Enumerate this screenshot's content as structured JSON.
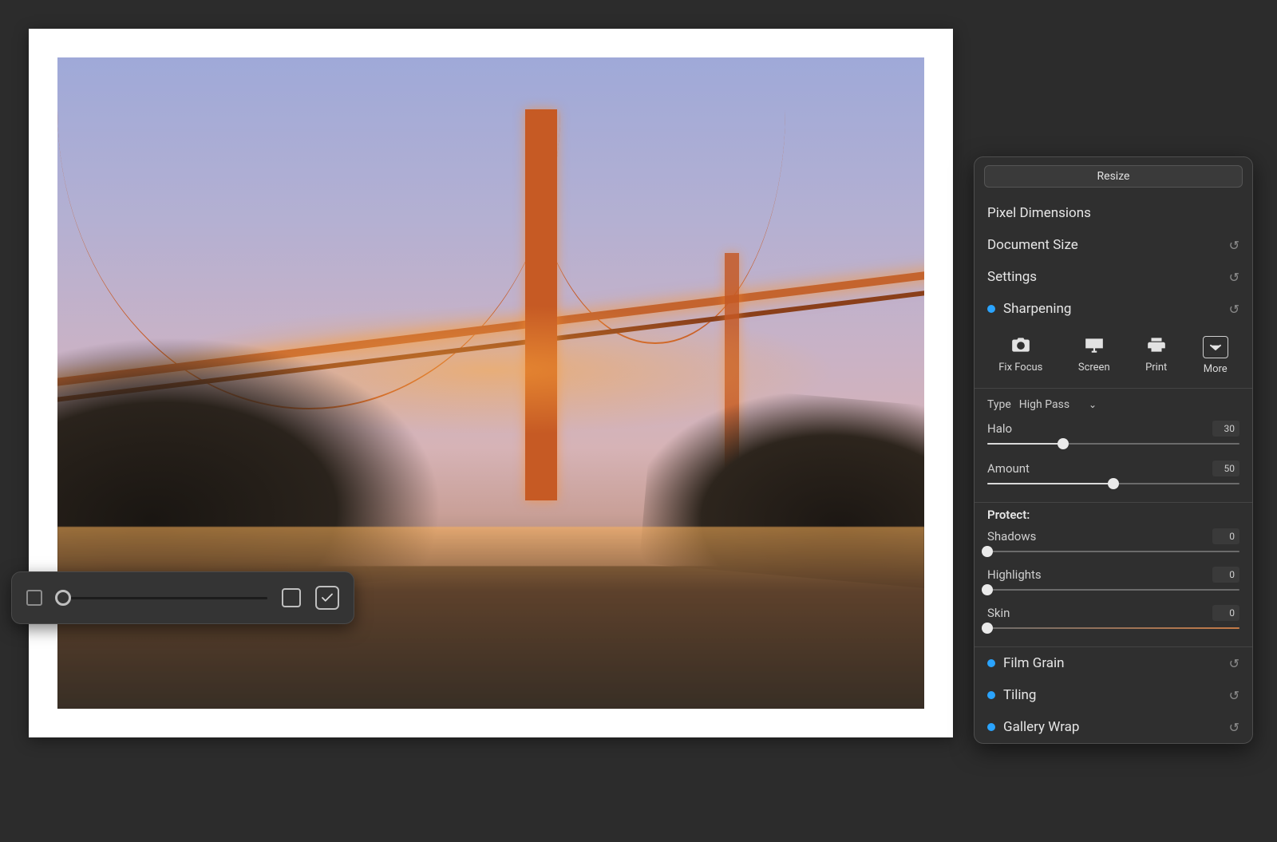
{
  "canvas": {
    "description": "Golden Gate Bridge at dusk, warm lights on bridge, purple sky, rocky beach foreground, reflections in wet sand"
  },
  "zoom_bar": {
    "slider_percent": 3
  },
  "panel": {
    "resize_label": "Resize",
    "sections": {
      "pixel_dimensions": "Pixel Dimensions",
      "document_size": "Document Size",
      "settings": "Settings",
      "sharpening": "Sharpening",
      "film_grain": "Film Grain",
      "tiling": "Tiling",
      "gallery_wrap": "Gallery Wrap"
    },
    "icons": {
      "fix_focus": "Fix Focus",
      "screen": "Screen",
      "print": "Print",
      "more": "More"
    },
    "type_label": "Type",
    "type_value": "High Pass",
    "halo": {
      "label": "Halo",
      "value": 30,
      "percent": 30
    },
    "amount": {
      "label": "Amount",
      "value": 50,
      "percent": 50
    },
    "protect_label": "Protect:",
    "shadows": {
      "label": "Shadows",
      "value": 0,
      "percent": 0
    },
    "highlights": {
      "label": "Highlights",
      "value": 0,
      "percent": 0
    },
    "skin": {
      "label": "Skin",
      "value": 0,
      "percent": 0
    }
  },
  "colors": {
    "accent": "#2aa4ff",
    "panel_bg": "#2f2f2f",
    "app_bg": "#2c2c2c"
  }
}
